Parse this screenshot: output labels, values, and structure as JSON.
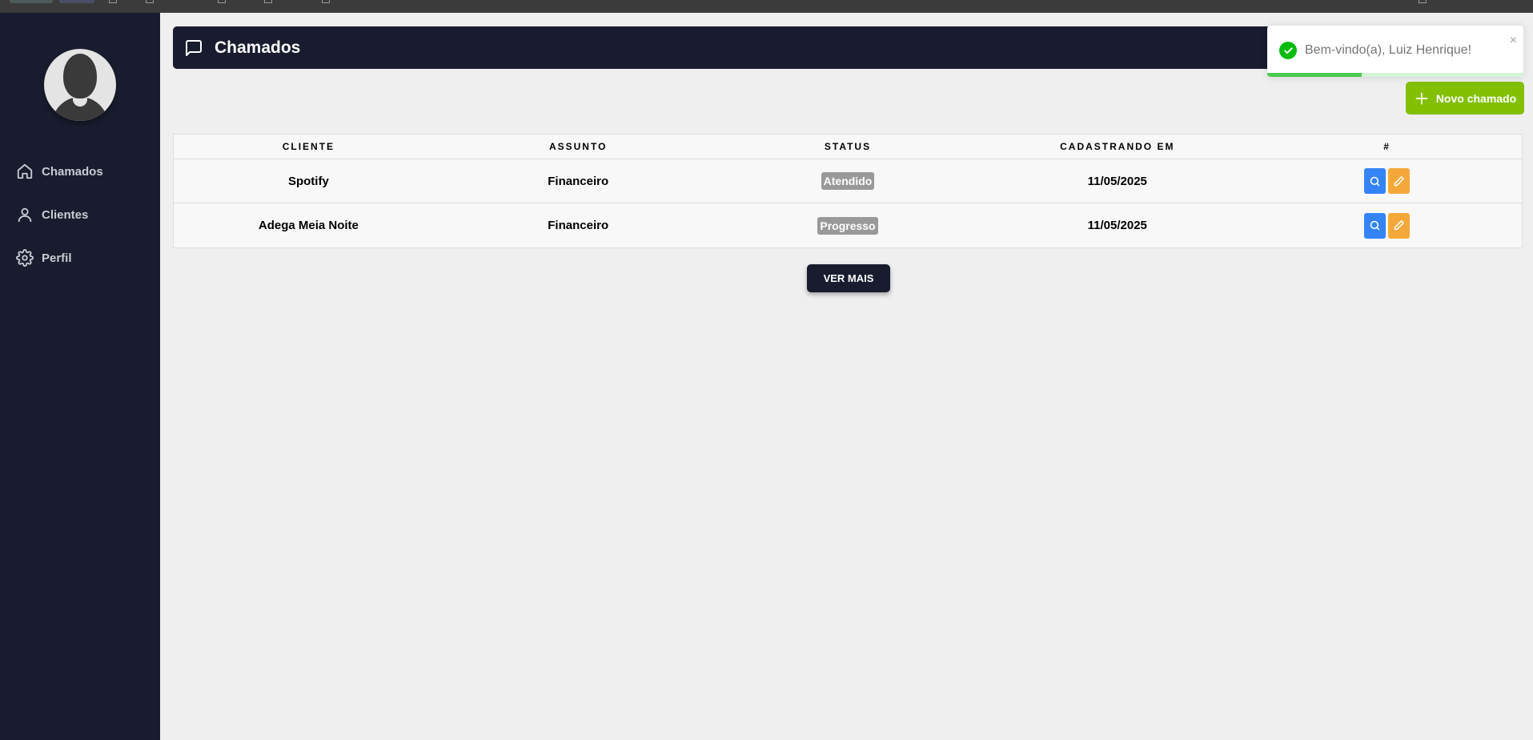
{
  "sidebar": {
    "items": [
      {
        "label": "Chamados",
        "icon": "home-icon"
      },
      {
        "label": "Clientes",
        "icon": "user-icon"
      },
      {
        "label": "Perfil",
        "icon": "gear-icon"
      }
    ]
  },
  "header": {
    "title": "Chamados",
    "icon": "message-icon"
  },
  "new_ticket_label": "Novo chamado",
  "table": {
    "columns": [
      "CLIENTE",
      "ASSUNTO",
      "STATUS",
      "CADASTRANDO EM",
      "#"
    ],
    "rows": [
      {
        "cliente": "Spotify",
        "assunto": "Financeiro",
        "status": "Atendido",
        "data": "11/05/2025"
      },
      {
        "cliente": "Adega Meia Noite",
        "assunto": "Financeiro",
        "status": "Progresso",
        "data": "11/05/2025"
      }
    ]
  },
  "more_label": "VER MAIS",
  "toast": {
    "message": "Bem-vindo(a), Luiz Henrique!",
    "close": "×",
    "progress": 0.37
  },
  "colors": {
    "sidebar_bg": "#181c2e",
    "accent_green": "#83bf02",
    "view_blue": "#3584f6",
    "edit_orange": "#f5a83a",
    "badge_gray": "#999999",
    "toast_success": "#07bc0c"
  }
}
